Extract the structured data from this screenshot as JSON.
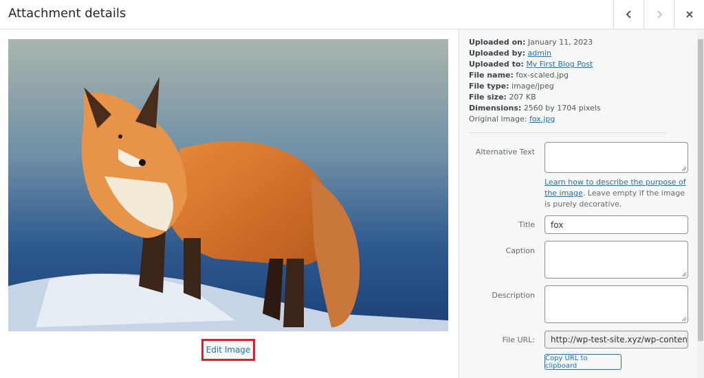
{
  "header": {
    "title": "Attachment details",
    "prev_label": "Previous",
    "next_label": "Next",
    "close_label": "Close"
  },
  "image": {
    "alt": "Red fox standing on snow",
    "edit_label": "Edit Image"
  },
  "meta": {
    "uploaded_on_label": "Uploaded on:",
    "uploaded_on": "January 11, 2023",
    "uploaded_by_label": "Uploaded by:",
    "uploaded_by": "admin",
    "uploaded_to_label": "Uploaded to:",
    "uploaded_to": "My First Blog Post",
    "file_name_label": "File name:",
    "file_name": "fox-scaled.jpg",
    "file_type_label": "File type:",
    "file_type": "image/jpeg",
    "file_size_label": "File size:",
    "file_size": "207 KB",
    "dimensions_label": "Dimensions:",
    "dimensions": "2560 by 1704 pixels",
    "original_label": "Original image:",
    "original": "fox.jpg"
  },
  "form": {
    "alt_label": "Alternative Text",
    "alt_value": "",
    "help_link": "Learn how to describe the purpose of the image",
    "help_text": ". Leave empty if the image is purely decorative.",
    "title_label": "Title",
    "title_value": "fox",
    "caption_label": "Caption",
    "caption_value": "",
    "description_label": "Description",
    "description_value": "",
    "url_label": "File URL:",
    "url_value": "http://wp-test-site.xyz/wp-content/",
    "copy_label": "Copy URL to clipboard"
  },
  "colors": {
    "accent": "#2271b1",
    "highlight": "#e01e2b"
  }
}
